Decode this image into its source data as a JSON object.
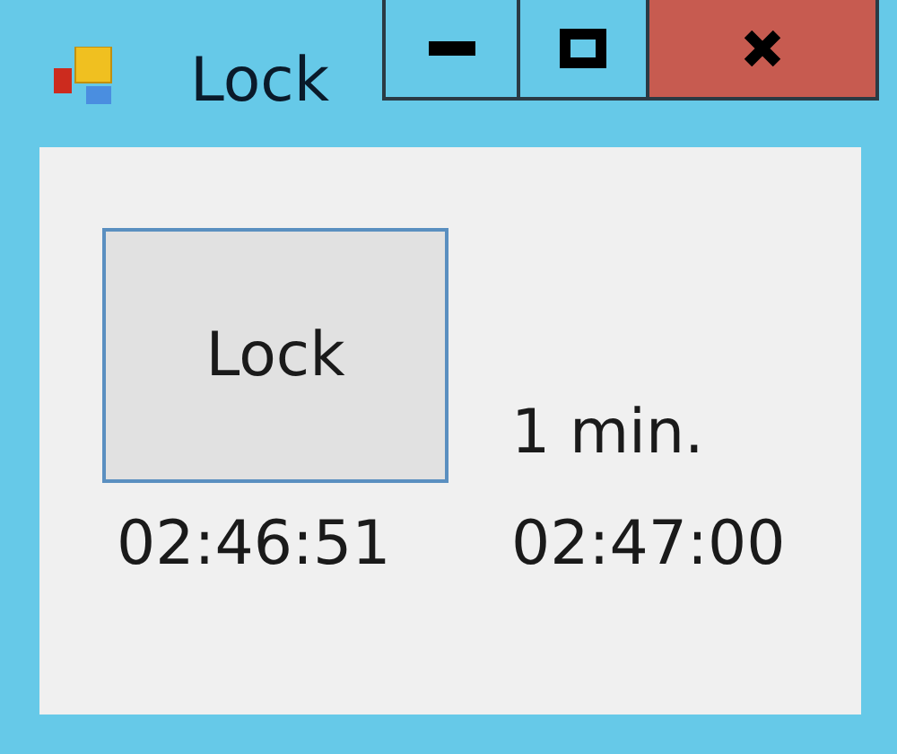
{
  "window": {
    "title": "Lock"
  },
  "lock_button": {
    "label": "Lock"
  },
  "interval": "1 min.",
  "times": [
    "02:46:51",
    "02:47:00"
  ]
}
